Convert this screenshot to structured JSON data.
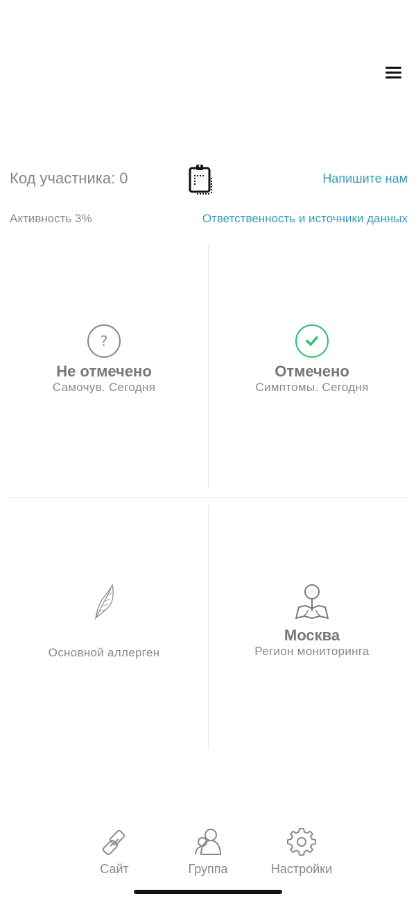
{
  "header": {
    "participant_label": "Код участника: 0",
    "write_us": "Напишите нам",
    "activity": "Активность 3%",
    "responsibility": "Ответственность и источники данных"
  },
  "tiles": [
    {
      "value": "Не отмечено",
      "subtitle": "Самочув. Сегодня",
      "icon": "question-icon"
    },
    {
      "value": "Отмечено",
      "subtitle": "Симптомы. Сегодня",
      "icon": "check-circle-icon",
      "icon_color": "#2fbf71"
    },
    {
      "value": "",
      "subtitle": "Основной аллерген",
      "icon": "leaf-icon"
    },
    {
      "value": "Москва",
      "subtitle": "Регион мониторинга",
      "icon": "map-pin-icon"
    }
  ],
  "tabbar": [
    {
      "label": "Сайт",
      "icon": "link-icon"
    },
    {
      "label": "Группа",
      "icon": "group-icon"
    },
    {
      "label": "Настройки",
      "icon": "gear-icon"
    }
  ],
  "colors": {
    "link": "#3a9bbd",
    "check": "#2fbf71",
    "text": "#7a7a7a"
  }
}
